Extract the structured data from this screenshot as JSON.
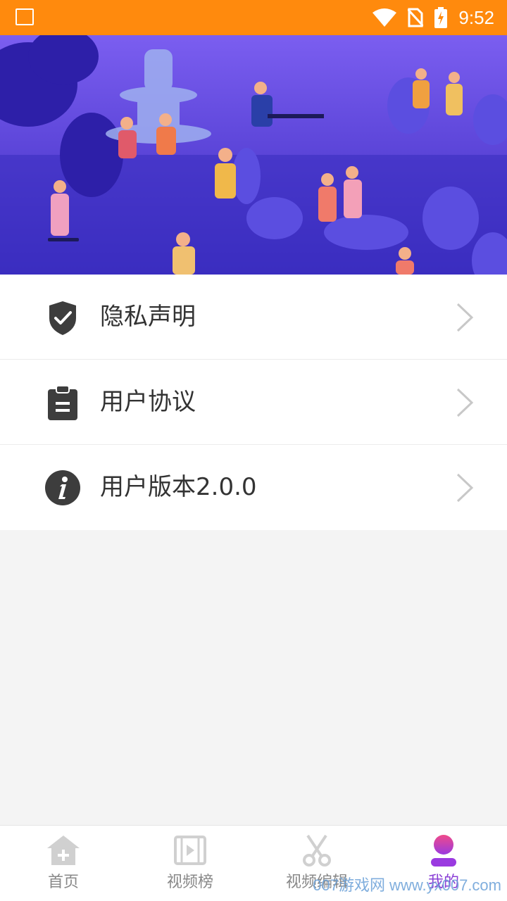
{
  "status": {
    "time": "9:52",
    "colors": {
      "bar": "#ff8a0d"
    }
  },
  "menu": {
    "items": [
      {
        "label": "隐私声明",
        "icon": "shield-check-icon"
      },
      {
        "label": "用户协议",
        "icon": "clipboard-icon"
      },
      {
        "label": "用户版本2.0.0",
        "icon": "info-icon"
      }
    ]
  },
  "nav": {
    "items": [
      {
        "label": "首页",
        "icon": "home-icon"
      },
      {
        "label": "视频榜",
        "icon": "film-icon"
      },
      {
        "label": "视频编辑",
        "icon": "scissors-icon"
      },
      {
        "label": "我的",
        "icon": "user-icon",
        "active": true
      }
    ]
  },
  "watermark": "007游戏网 www.yx007.com"
}
